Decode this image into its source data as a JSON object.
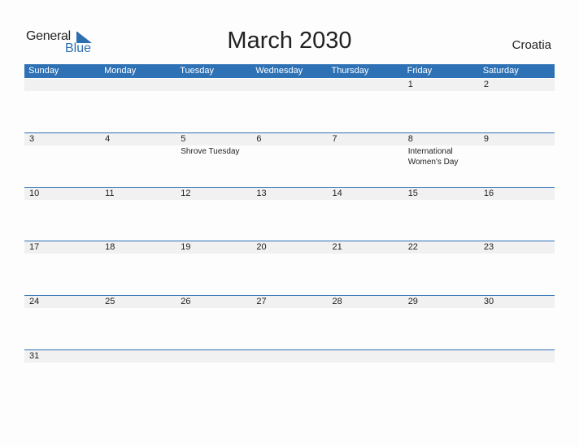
{
  "logo": {
    "general": "General",
    "blue": "Blue"
  },
  "title": "March 2030",
  "country": "Croatia",
  "colors": {
    "accent": "#2e72b5",
    "row_strip": "#f1f1f1"
  },
  "weekdays": [
    "Sunday",
    "Monday",
    "Tuesday",
    "Wednesday",
    "Thursday",
    "Friday",
    "Saturday"
  ],
  "weeks": [
    [
      {
        "d": ""
      },
      {
        "d": ""
      },
      {
        "d": ""
      },
      {
        "d": ""
      },
      {
        "d": ""
      },
      {
        "d": "1"
      },
      {
        "d": "2"
      }
    ],
    [
      {
        "d": "3"
      },
      {
        "d": "4"
      },
      {
        "d": "5",
        "event": "Shrove Tuesday"
      },
      {
        "d": "6"
      },
      {
        "d": "7"
      },
      {
        "d": "8",
        "event": "International Women's Day"
      },
      {
        "d": "9"
      }
    ],
    [
      {
        "d": "10"
      },
      {
        "d": "11"
      },
      {
        "d": "12"
      },
      {
        "d": "13"
      },
      {
        "d": "14"
      },
      {
        "d": "15"
      },
      {
        "d": "16"
      }
    ],
    [
      {
        "d": "17"
      },
      {
        "d": "18"
      },
      {
        "d": "19"
      },
      {
        "d": "20"
      },
      {
        "d": "21"
      },
      {
        "d": "22"
      },
      {
        "d": "23"
      }
    ],
    [
      {
        "d": "24"
      },
      {
        "d": "25"
      },
      {
        "d": "26"
      },
      {
        "d": "27"
      },
      {
        "d": "28"
      },
      {
        "d": "29"
      },
      {
        "d": "30"
      }
    ],
    [
      {
        "d": "31"
      },
      {
        "d": ""
      },
      {
        "d": ""
      },
      {
        "d": ""
      },
      {
        "d": ""
      },
      {
        "d": ""
      },
      {
        "d": ""
      }
    ]
  ]
}
